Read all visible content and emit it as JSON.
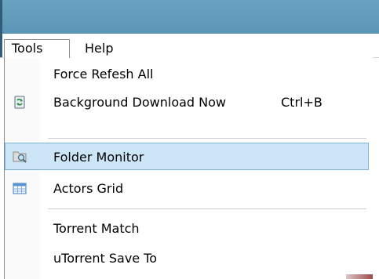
{
  "menubar": {
    "tools_label": "Tools",
    "help_label": "Help"
  },
  "menu": {
    "items": [
      {
        "label": "Force Refesh All",
        "icon": "",
        "shortcut": ""
      },
      {
        "label": "Background Download Now",
        "icon": "download-refresh-icon",
        "shortcut": "Ctrl+B"
      },
      {
        "label": "Folder Monitor",
        "icon": "folder-monitor-icon",
        "shortcut": "",
        "highlighted": true
      },
      {
        "label": "Actors Grid",
        "icon": "grid-icon",
        "shortcut": ""
      },
      {
        "label": "Torrent Match",
        "icon": "",
        "shortcut": ""
      },
      {
        "label": "uTorrent Save To",
        "icon": "",
        "shortcut": ""
      }
    ]
  },
  "colors": {
    "titlebar": "#6aa3c1",
    "highlight_bg": "#cde6f7",
    "highlight_border": "#7fb5dc"
  }
}
